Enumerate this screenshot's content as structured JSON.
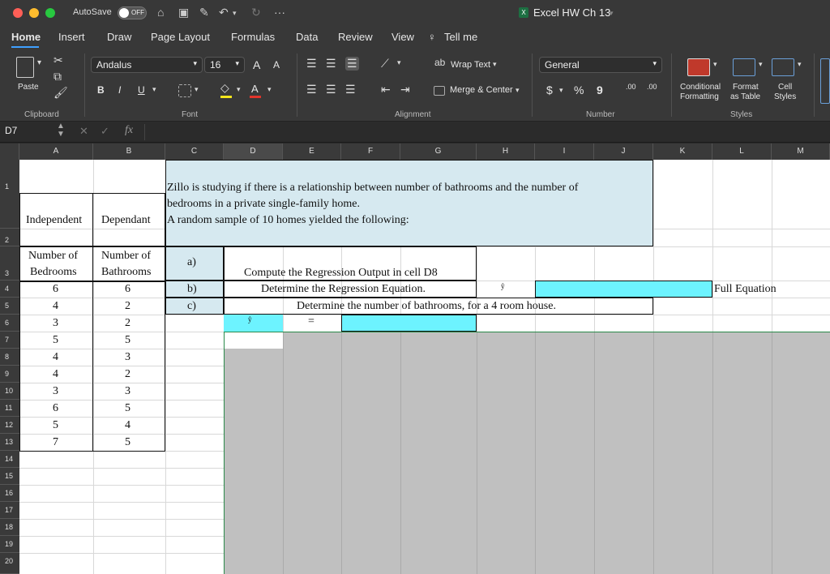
{
  "titlebar": {
    "autosave": "AutoSave",
    "autosave_state": "OFF",
    "doc_title": "Excel HW Ch 13",
    "more": "···"
  },
  "tabs": [
    "Home",
    "Insert",
    "Draw",
    "Page Layout",
    "Formulas",
    "Data",
    "Review",
    "View",
    "Tell me"
  ],
  "ribbon": {
    "paste": "Paste",
    "clipboard": "Clipboard",
    "font_name": "Andalus",
    "font_size": "16",
    "font_group": "Font",
    "bold": "B",
    "italic": "I",
    "underline": "U",
    "wrap_text": "Wrap Text",
    "merge_center": "Merge & Center",
    "alignment_group": "Alignment",
    "number_format": "General",
    "currency": "$",
    "percent": "%",
    "comma": "9",
    "number_group": "Number",
    "conditional_1": "Conditional",
    "conditional_2": "Formatting",
    "format_table_1": "Format",
    "format_table_2": "as Table",
    "cell_styles_1": "Cell",
    "cell_styles_2": "Styles",
    "styles_group": "Styles",
    "font_grow": "A",
    "font_shrink": "A",
    "dec_inc": ".00",
    "dec_dec": ".00"
  },
  "formula_bar": {
    "name_box": "D7",
    "fx": "fx",
    "value": ""
  },
  "columns": [
    "A",
    "B",
    "C",
    "D",
    "E",
    "F",
    "G",
    "H",
    "I",
    "J",
    "K",
    "L",
    "M"
  ],
  "rows": [
    "1",
    "2",
    "3",
    "4",
    "5",
    "6",
    "7",
    "8",
    "9",
    "10",
    "11",
    "12",
    "13",
    "14",
    "15",
    "16",
    "17",
    "18",
    "19",
    "20"
  ],
  "sheet": {
    "intro_line1": "Zillo is studying if there is a relationship between number of bathrooms and the number of",
    "intro_line2": "bedrooms in a private single-family home.",
    "intro_line3": "A random sample of 10 homes yielded the following:",
    "independent": "Independent",
    "dependant": "Dependant",
    "col_a_header1": "Number of",
    "col_a_header2": "Bedrooms",
    "col_b_header1": "Number of",
    "col_b_header2": "Bathrooms",
    "bedrooms": [
      "6",
      "4",
      "3",
      "5",
      "4",
      "4",
      "3",
      "6",
      "5",
      "7"
    ],
    "bathrooms": [
      "6",
      "2",
      "2",
      "5",
      "3",
      "2",
      "3",
      "5",
      "4",
      "5"
    ],
    "q_a": "a)",
    "q_b": "b)",
    "q_c": "c)",
    "task_a": "Compute the Regression Output in cell D8",
    "task_b": "Determine the Regression Equation.",
    "task_c": "Determine the number of  bathrooms, for a 4 room house.",
    "yhat": "ŷ",
    "equals": "=",
    "full_equation": "Full Equation"
  }
}
